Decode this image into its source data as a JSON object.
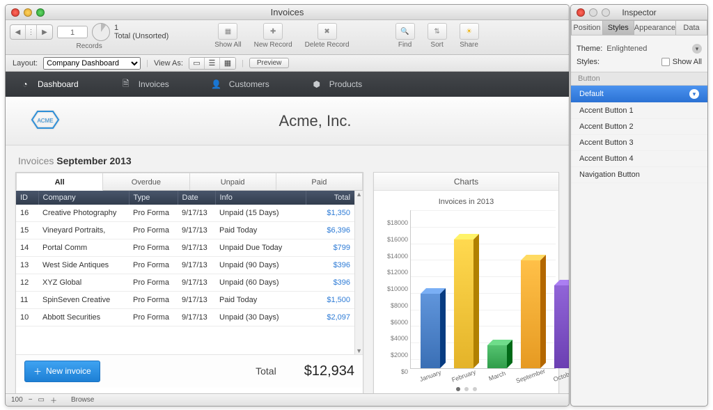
{
  "window": {
    "title": "Invoices"
  },
  "toolbar": {
    "record_number": "1",
    "record_total_top": "1",
    "record_total_bottom": "Total (Unsorted)",
    "records_label": "Records",
    "actions": [
      "Show All",
      "New Record",
      "Delete Record",
      "Find",
      "Sort",
      "Share"
    ]
  },
  "subbar": {
    "layout_label": "Layout:",
    "layout_value": "Company Dashboard",
    "viewas_label": "View As:",
    "preview_label": "Preview"
  },
  "nav": {
    "items": [
      {
        "label": "Dashboard",
        "icon": "dashboard-icon"
      },
      {
        "label": "Invoices",
        "icon": "invoice-icon"
      },
      {
        "label": "Customers",
        "icon": "user-icon"
      },
      {
        "label": "Products",
        "icon": "box-icon"
      }
    ]
  },
  "header": {
    "logo_text": "ACME",
    "company": "Acme, Inc."
  },
  "period": {
    "prefix": "Invoices",
    "value": "September 2013"
  },
  "invoice_tabs": [
    "All",
    "Overdue",
    "Unpaid",
    "Paid"
  ],
  "table": {
    "columns": [
      "ID",
      "Company",
      "Type",
      "Date",
      "Info",
      "Total"
    ],
    "rows": [
      {
        "id": "16",
        "company": "Creative Photography",
        "type": "Pro Forma",
        "date": "9/17/13",
        "info": "Unpaid (15 Days)",
        "total": "$1,350"
      },
      {
        "id": "15",
        "company": "Vineyard Portraits,",
        "type": "Pro Forma",
        "date": "9/17/13",
        "info": "Paid Today",
        "total": "$6,396"
      },
      {
        "id": "14",
        "company": "Portal Comm",
        "type": "Pro Forma",
        "date": "9/17/13",
        "info": "Unpaid Due Today",
        "total": "$799"
      },
      {
        "id": "13",
        "company": "West Side Antiques",
        "type": "Pro Forma",
        "date": "9/17/13",
        "info": "Unpaid (90 Days)",
        "total": "$396"
      },
      {
        "id": "12",
        "company": "XYZ Global",
        "type": "Pro Forma",
        "date": "9/17/13",
        "info": "Unpaid (60 Days)",
        "total": "$396"
      },
      {
        "id": "11",
        "company": "SpinSeven Creative",
        "type": "Pro Forma",
        "date": "9/17/13",
        "info": "Paid Today",
        "total": "$1,500"
      },
      {
        "id": "10",
        "company": "Abbott Securities",
        "type": "Pro Forma",
        "date": "9/17/13",
        "info": "Unpaid (30 Days)",
        "total": "$2,097"
      }
    ],
    "total_label": "Total",
    "total_value": "$12,934",
    "new_invoice_label": "New invoice"
  },
  "charts": {
    "tab_label": "Charts",
    "title": "Invoices in 2013"
  },
  "chart_data": {
    "type": "bar",
    "title": "Invoices in 2013",
    "xlabel": "",
    "ylabel": "",
    "ylim": [
      0,
      18000
    ],
    "yticks": [
      0,
      2000,
      4000,
      6000,
      8000,
      10000,
      12000,
      14000,
      16000,
      18000
    ],
    "categories": [
      "January",
      "February",
      "March",
      "September",
      "October"
    ],
    "values": [
      9000,
      15600,
      2800,
      13000,
      10000
    ],
    "colors": [
      "#3a6fb5",
      "#e4b329",
      "#2f9d4a",
      "#e69a22",
      "#6b3fb2"
    ]
  },
  "statusbar": {
    "zoom": "100",
    "mode": "Browse"
  },
  "inspector": {
    "window_title": "Inspector",
    "tabs": [
      "Position",
      "Styles",
      "Appearance",
      "Data"
    ],
    "active_tab": "Styles",
    "theme_label": "Theme:",
    "theme_value": "Enlightened",
    "styles_label": "Styles:",
    "show_all_label": "Show All",
    "section_header": "Button",
    "style_items": [
      "Default",
      "Accent Button 1",
      "Accent Button 2",
      "Accent Button 3",
      "Accent Button 4",
      "Navigation Button"
    ],
    "selected_style": "Default"
  }
}
